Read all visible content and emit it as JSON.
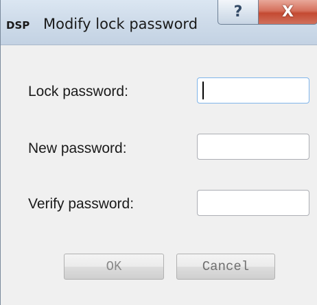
{
  "window": {
    "app_badge": "DSP",
    "title": "Modify lock password",
    "help_glyph": "?",
    "close_glyph": "X"
  },
  "form": {
    "fields": [
      {
        "label": "Lock password:",
        "value": ""
      },
      {
        "label": "New password:",
        "value": ""
      },
      {
        "label": "Verify password:",
        "value": ""
      }
    ]
  },
  "buttons": {
    "ok": "OK",
    "cancel": "Cancel"
  },
  "icons": {
    "app": "dsp-app-icon",
    "help": "help-icon",
    "close": "close-icon"
  }
}
